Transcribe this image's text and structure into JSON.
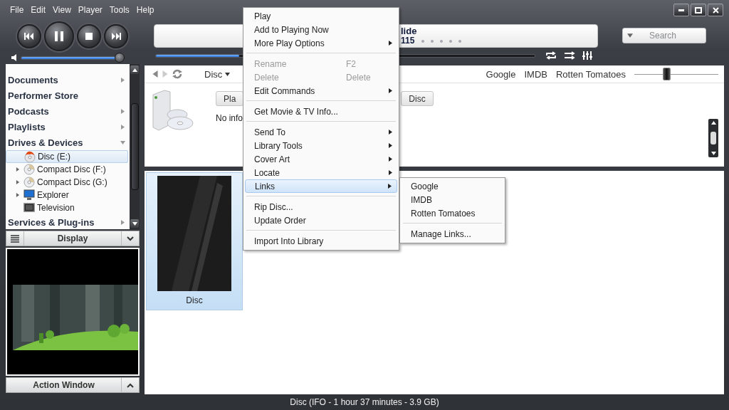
{
  "menu_bar": {
    "items": [
      "File",
      "Edit",
      "View",
      "Player",
      "Tools",
      "Help"
    ]
  },
  "player": {
    "now_playing": {
      "title": "lide",
      "number": "115",
      "stars": 0
    },
    "volume": {
      "level": 0.97
    },
    "progress": {
      "level": 0.22
    },
    "search": {
      "placeholder": "Search"
    }
  },
  "sidebar": {
    "items": [
      {
        "label": "Documents",
        "kind": "group",
        "expanded": false
      },
      {
        "label": "Performer Store",
        "kind": "link"
      },
      {
        "label": "Podcasts",
        "kind": "group",
        "expanded": false
      },
      {
        "label": "Playlists",
        "kind": "group",
        "expanded": false
      },
      {
        "label": "Drives & Devices",
        "kind": "group",
        "expanded": true,
        "children": [
          {
            "label": "Disc (E:)",
            "kind": "disc",
            "expandable": false,
            "selected": true
          },
          {
            "label": "Compact Disc (F:)",
            "kind": "cd",
            "expandable": true,
            "selected": false
          },
          {
            "label": "Compact Disc (G:)",
            "kind": "cd",
            "expandable": true,
            "selected": false
          },
          {
            "label": "Explorer",
            "kind": "computer",
            "expandable": true,
            "selected": false
          },
          {
            "label": "Television",
            "kind": "tv",
            "expandable": false,
            "selected": false
          }
        ]
      },
      {
        "label": "Services & Plug-ins",
        "kind": "group",
        "expanded": false
      }
    ]
  },
  "display_panel": {
    "title": "Display"
  },
  "action_window": {
    "title": "Action Window"
  },
  "view_toolbar": {
    "location": "Disc",
    "links": [
      "Google",
      "IMDB",
      "Rotten Tomatoes"
    ],
    "zoom": {
      "level": 0.38
    }
  },
  "info_pane": {
    "buttons": [
      "Pla",
      "Disc"
    ],
    "message": "No info"
  },
  "tiles": [
    {
      "label": "Disc",
      "selected": true
    }
  ],
  "context_menu": {
    "groups": [
      [
        {
          "label": "Play",
          "submenu": false,
          "disabled": false,
          "selected": false
        },
        {
          "label": "Add to Playing Now",
          "submenu": false,
          "disabled": false,
          "selected": false
        },
        {
          "label": "More Play Options",
          "submenu": true,
          "disabled": false,
          "selected": false
        }
      ],
      [
        {
          "label": "Rename",
          "shortcut": "F2",
          "submenu": false,
          "disabled": true,
          "selected": false
        },
        {
          "label": "Delete",
          "shortcut": "Delete",
          "submenu": false,
          "disabled": true,
          "selected": false
        },
        {
          "label": "Edit Commands",
          "submenu": true,
          "disabled": false,
          "selected": false
        }
      ],
      [
        {
          "label": "Get Movie & TV Info...",
          "submenu": false,
          "disabled": false,
          "selected": false
        }
      ],
      [
        {
          "label": "Send To",
          "submenu": true,
          "disabled": false,
          "selected": false
        },
        {
          "label": "Library Tools",
          "submenu": true,
          "disabled": false,
          "selected": false
        },
        {
          "label": "Cover Art",
          "submenu": true,
          "disabled": false,
          "selected": false
        },
        {
          "label": "Locate",
          "submenu": true,
          "disabled": false,
          "selected": false
        },
        {
          "label": "Links",
          "submenu": true,
          "disabled": false,
          "selected": true
        }
      ],
      [
        {
          "label": "Rip Disc...",
          "submenu": false,
          "disabled": false,
          "selected": false
        },
        {
          "label": "Update Order",
          "submenu": false,
          "disabled": false,
          "selected": false
        }
      ],
      [
        {
          "label": "Import Into Library",
          "submenu": false,
          "disabled": false,
          "selected": false
        }
      ]
    ]
  },
  "links_submenu": {
    "groups": [
      [
        "Google",
        "IMDB",
        "Rotten Tomatoes"
      ],
      [
        "Manage Links..."
      ]
    ]
  },
  "status_bar": {
    "text": "Disc (IFO - 1 hour 37 minutes - 3.9 GB)"
  }
}
